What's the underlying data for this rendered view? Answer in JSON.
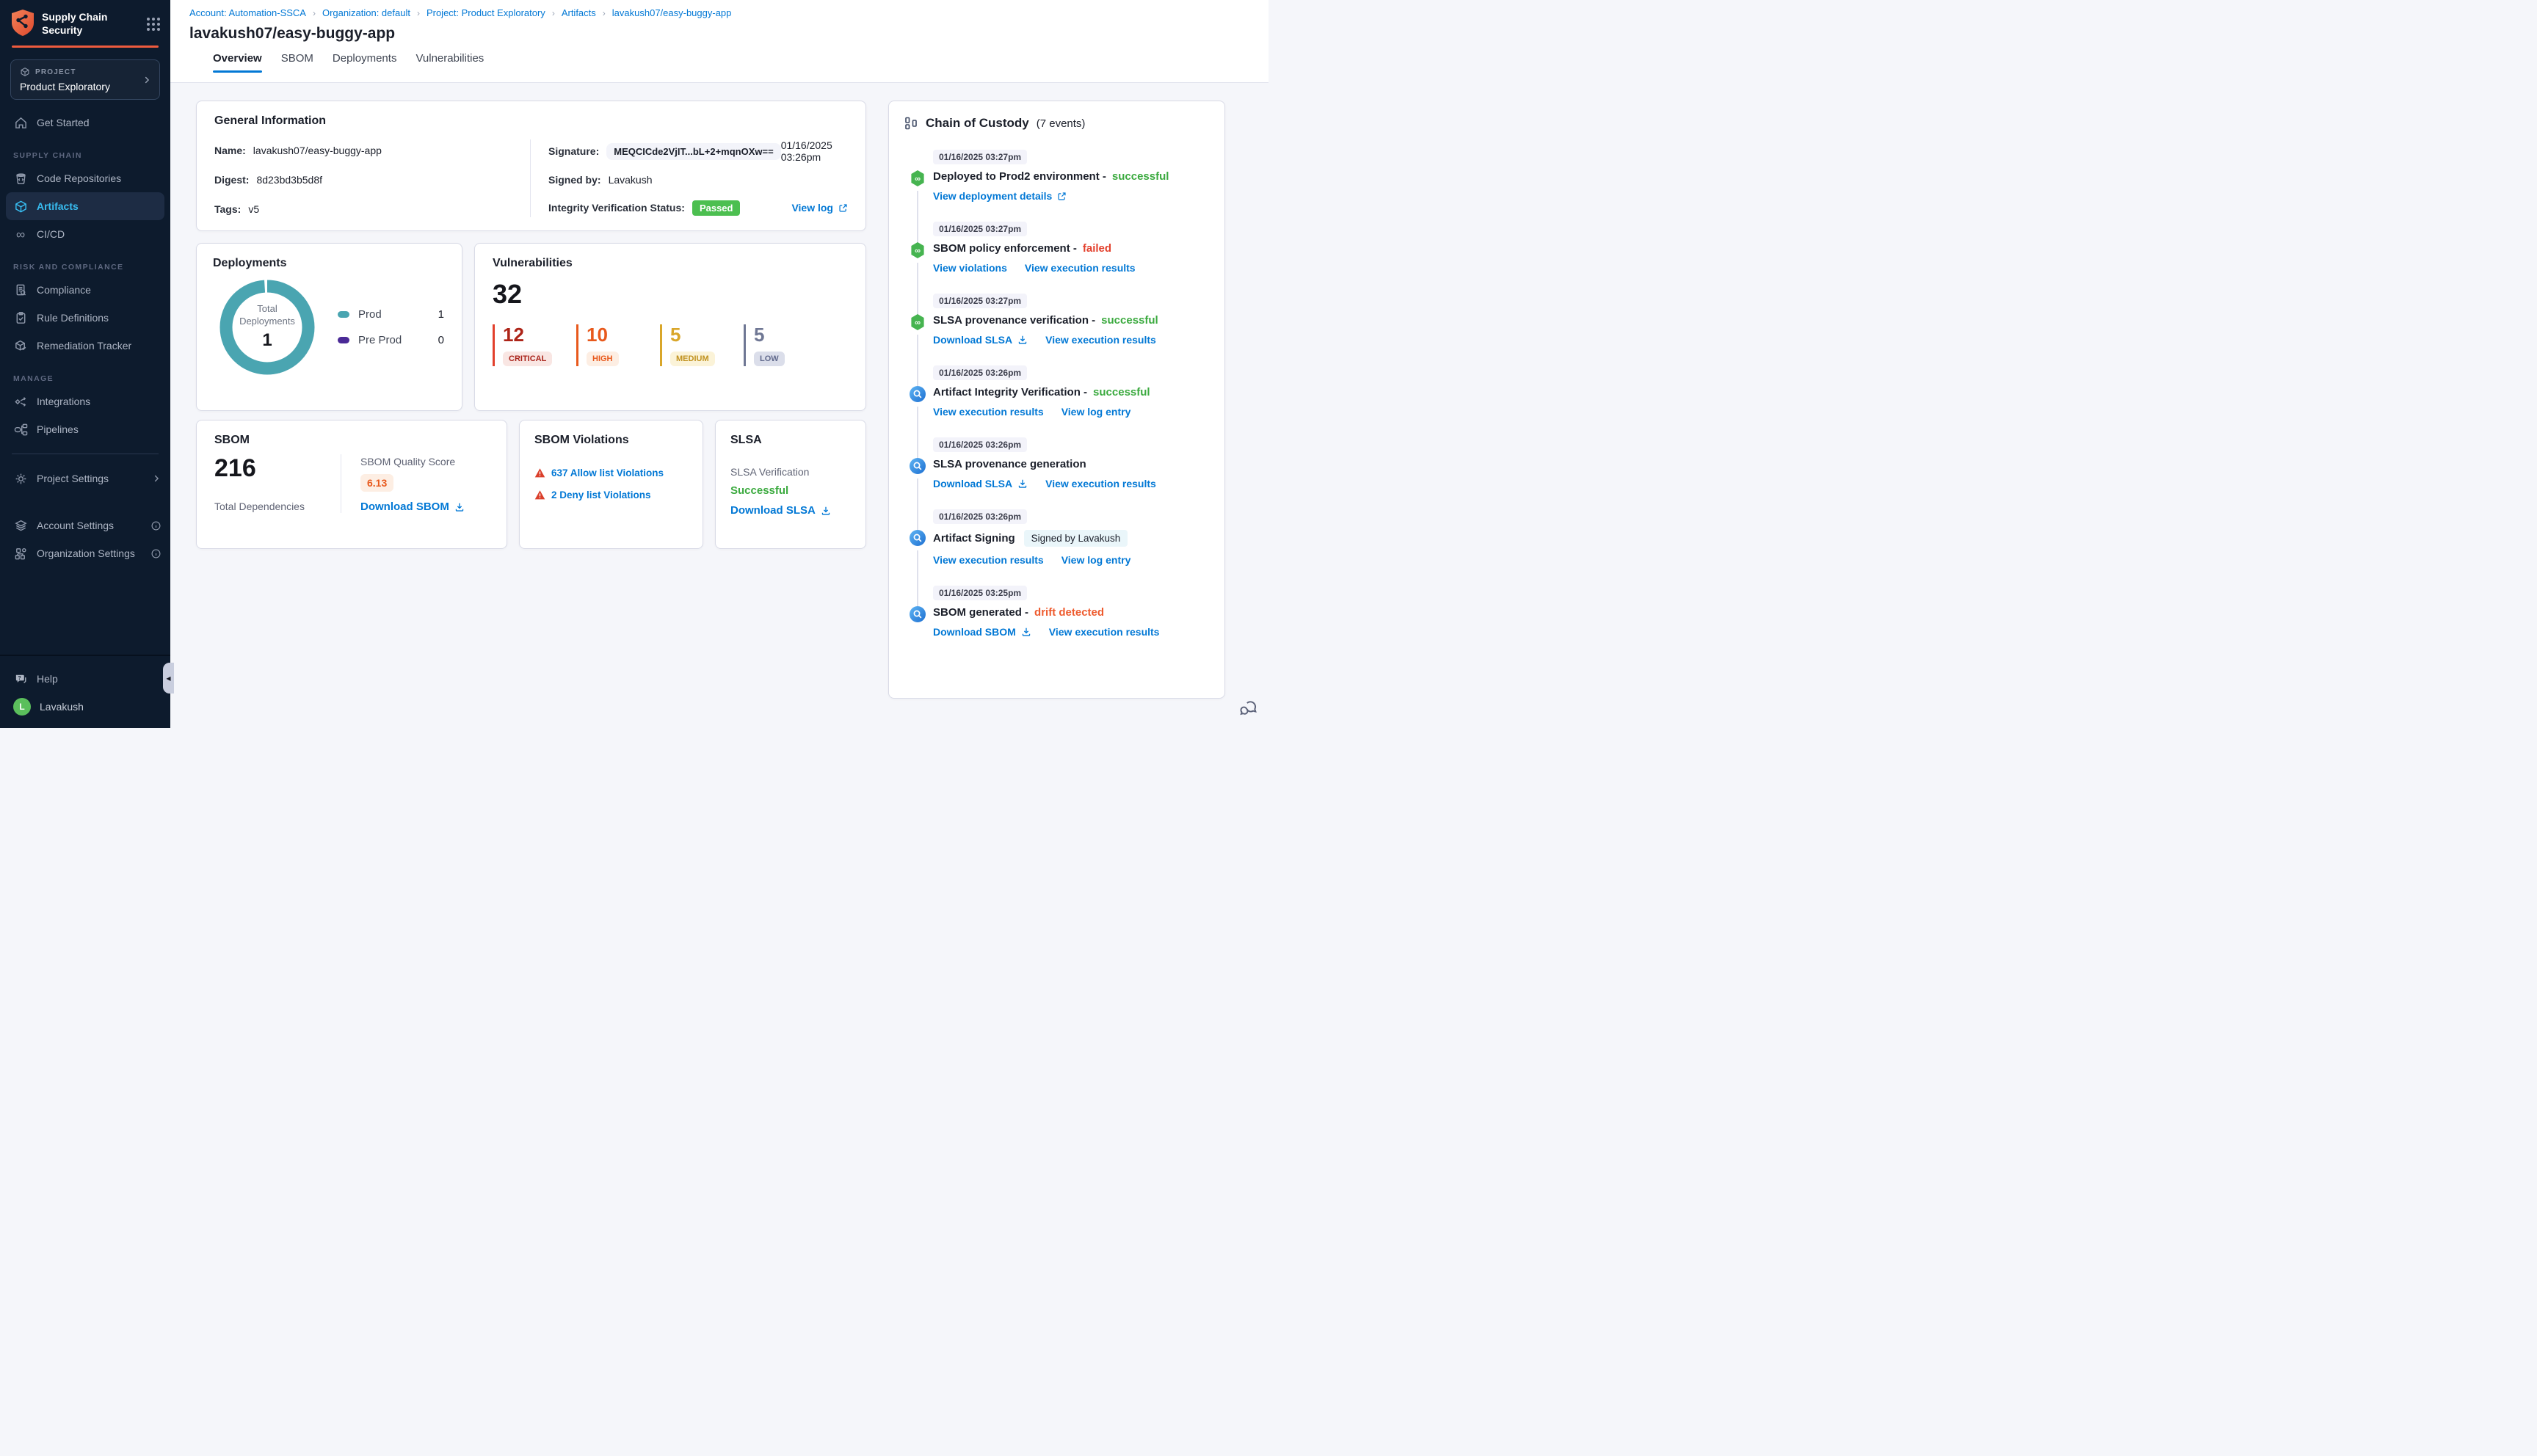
{
  "app": {
    "brand": "Supply Chain Security"
  },
  "colors": {
    "accent_blue": "#0278D5",
    "success_green": "#3BAA3F",
    "passed_badge_green": "#4CBF50",
    "fail_red": "#E3402C",
    "drift_orange": "#EE5B2E",
    "sidebar_accent_orange": "#EE5B3E",
    "active_nav_blue": "#38BDF1",
    "donut_teal": "#4AA5B1",
    "preprod_purple": "#4A2A96"
  },
  "sidebar": {
    "project": {
      "label": "PROJECT",
      "name": "Product Exploratory"
    },
    "primary": [
      {
        "label": "Get Started",
        "icon": "home"
      }
    ],
    "sections": [
      {
        "label": "SUPPLY CHAIN",
        "items": [
          {
            "label": "Code Repositories",
            "icon": "repo"
          },
          {
            "label": "Artifacts",
            "icon": "cube",
            "active": true
          },
          {
            "label": "CI/CD",
            "icon": "infinity"
          }
        ]
      },
      {
        "label": "RISK AND COMPLIANCE",
        "items": [
          {
            "label": "Compliance",
            "icon": "doc-search"
          },
          {
            "label": "Rule Definitions",
            "icon": "clipboard-check"
          },
          {
            "label": "Remediation Tracker",
            "icon": "cube-edit"
          }
        ]
      },
      {
        "label": "MANAGE",
        "items": [
          {
            "label": "Integrations",
            "icon": "integrations"
          },
          {
            "label": "Pipelines",
            "icon": "pipelines"
          }
        ]
      }
    ],
    "settings": [
      {
        "label": "Project Settings",
        "icon": "gear",
        "trailing": "chevron"
      },
      {
        "label": "Account Settings",
        "icon": "layers",
        "trailing": "info",
        "gap": true
      },
      {
        "label": "Organization Settings",
        "icon": "org",
        "trailing": "info"
      }
    ],
    "help_label": "Help",
    "user": {
      "name": "Lavakush",
      "initial": "L"
    }
  },
  "header": {
    "breadcrumbs": [
      "Account: Automation-SSCA",
      "Organization: default",
      "Project: Product Exploratory",
      "Artifacts",
      "lavakush07/easy-buggy-app"
    ],
    "title": "lavakush07/easy-buggy-app",
    "tabs": [
      {
        "label": "Overview",
        "active": true
      },
      {
        "label": "SBOM"
      },
      {
        "label": "Deployments"
      },
      {
        "label": "Vulnerabilities"
      }
    ]
  },
  "general_info": {
    "title": "General Information",
    "name_label": "Name:",
    "name": "lavakush07/easy-buggy-app",
    "digest_label": "Digest:",
    "digest": "8d23bd3b5d8f",
    "tags_label": "Tags:",
    "tags": "v5",
    "signature_label": "Signature:",
    "signature": "MEQCICde2VjIT...bL+2+mqnOXw==",
    "signature_date": "01/16/2025 03:26pm",
    "signed_by_label": "Signed by:",
    "signed_by": "Lavakush",
    "integrity_label": "Integrity Verification Status:",
    "integrity_status": "Passed",
    "view_log_label": "View log"
  },
  "deployments": {
    "title": "Deployments",
    "center_label_1": "Total",
    "center_label_2": "Deployments",
    "total": "1",
    "ring_color": "#4AA5B1",
    "legend": [
      {
        "label": "Prod",
        "value": "1",
        "color": "#4AA5B1"
      },
      {
        "label": "Pre Prod",
        "value": "0",
        "color": "#4A2A96"
      }
    ]
  },
  "vulnerabilities": {
    "title": "Vulnerabilities",
    "total": "32",
    "severities": [
      {
        "label": "CRITICAL",
        "value": "12",
        "num_color": "#AD2418",
        "bar_color": "#E2402C",
        "chip_bg": "#F9E6E3",
        "chip_text": "#A9231A"
      },
      {
        "label": "HIGH",
        "value": "10",
        "num_color": "#E8591C",
        "bar_color": "#E8591C",
        "chip_bg": "#FDEEE3",
        "chip_text": "#E8591C"
      },
      {
        "label": "MEDIUM",
        "value": "5",
        "num_color": "#D9A62A",
        "bar_color": "#D9A62A",
        "chip_bg": "#FBF3D8",
        "chip_text": "#C1921F"
      },
      {
        "label": "LOW",
        "value": "5",
        "num_color": "#6F7794",
        "bar_color": "#6F7794",
        "chip_bg": "#DBDEEA",
        "chip_text": "#61698C"
      }
    ]
  },
  "sbom": {
    "title": "SBOM",
    "total": "216",
    "total_label": "Total Dependencies",
    "quality_label": "SBOM Quality Score",
    "quality_score": "6.13",
    "download_label": "Download SBOM"
  },
  "sbom_violations": {
    "title": "SBOM Violations",
    "items": [
      {
        "label": "637 Allow list Violations"
      },
      {
        "label": "2 Deny list Violations"
      }
    ]
  },
  "slsa": {
    "title": "SLSA",
    "verification_label": "SLSA Verification",
    "status": "Successful",
    "download_label": "Download SLSA"
  },
  "chain": {
    "title": "Chain of Custody",
    "count": "(7 events)",
    "events": [
      {
        "time": "01/16/2025 03:27pm",
        "icon": "pipeline",
        "title": "Deployed to Prod2 environment",
        "status": "successful",
        "status_type": "green",
        "links": [
          {
            "label": "View deployment details",
            "icon": "external"
          }
        ]
      },
      {
        "time": "01/16/2025 03:27pm",
        "icon": "pipeline",
        "title": "SBOM policy enforcement",
        "status": "failed",
        "status_type": "red",
        "links": [
          {
            "label": "View violations"
          },
          {
            "label": "View execution results"
          }
        ]
      },
      {
        "time": "01/16/2025 03:27pm",
        "icon": "pipeline",
        "title": "SLSA provenance verification",
        "status": "successful",
        "status_type": "green",
        "links": [
          {
            "label": "Download SLSA",
            "icon": "download"
          },
          {
            "label": "View execution results"
          }
        ]
      },
      {
        "time": "01/16/2025 03:26pm",
        "icon": "scan",
        "title": "Artifact Integrity Verification",
        "status": "successful",
        "status_type": "green",
        "links": [
          {
            "label": "View execution results"
          },
          {
            "label": "View log entry"
          }
        ]
      },
      {
        "time": "01/16/2025 03:26pm",
        "icon": "scan",
        "title": "SLSA provenance generation",
        "links": [
          {
            "label": "Download SLSA",
            "icon": "download"
          },
          {
            "label": "View execution results"
          }
        ]
      },
      {
        "time": "01/16/2025 03:26pm",
        "icon": "scan",
        "title": "Artifact Signing",
        "badge": "Signed by Lavakush",
        "links": [
          {
            "label": "View execution results"
          },
          {
            "label": "View log entry"
          }
        ]
      },
      {
        "time": "01/16/2025 03:25pm",
        "icon": "scan",
        "title": "SBOM generated",
        "status": "drift detected",
        "status_type": "orange",
        "links": [
          {
            "label": "Download SBOM",
            "icon": "download"
          },
          {
            "label": "View execution results"
          }
        ]
      }
    ]
  }
}
